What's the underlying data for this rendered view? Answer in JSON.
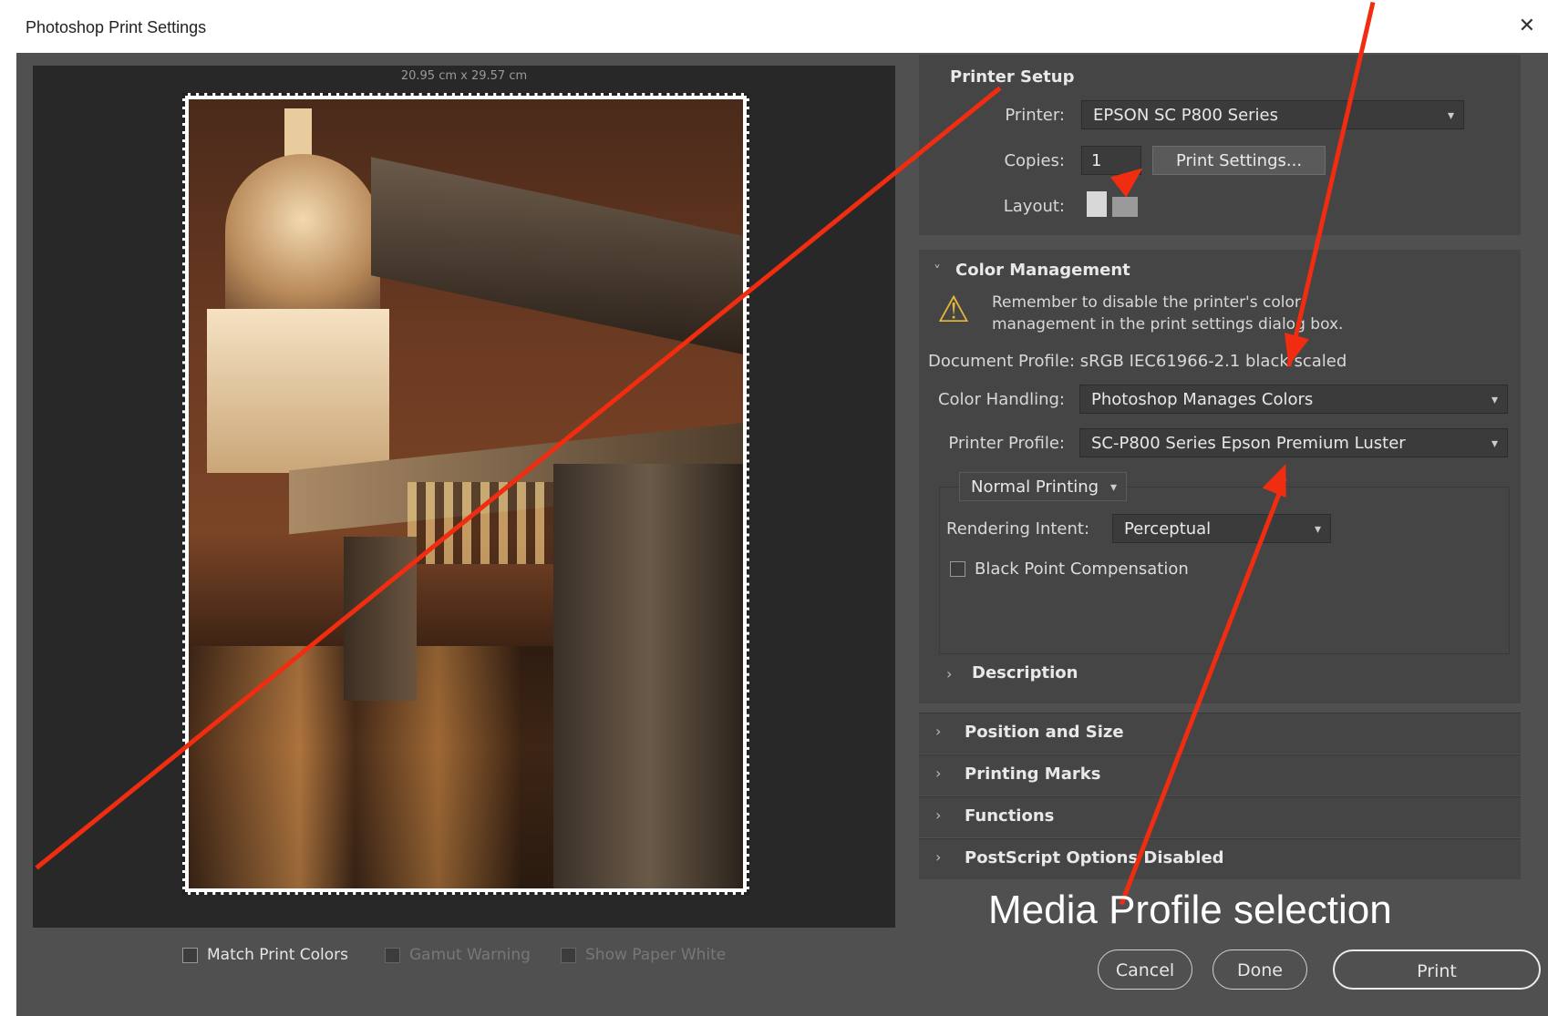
{
  "window": {
    "title": "Photoshop Print Settings",
    "close_glyph": "✕"
  },
  "preview": {
    "size_label": "20.95 cm x 29.57 cm",
    "photo_description_icon": "photo-preview-image"
  },
  "bottom_options": {
    "match_print_colors": "Match Print Colors",
    "gamut_warning": "Gamut Warning",
    "show_paper_white": "Show Paper White"
  },
  "printer_setup": {
    "title": "Printer Setup",
    "printer_label": "Printer:",
    "printer_value": "EPSON SC P800 Series",
    "copies_label": "Copies:",
    "copies_value": "1",
    "print_settings_button": "Print Settings...",
    "layout_label": "Layout:"
  },
  "color_management": {
    "title": "Color Management",
    "warning_line1": "Remember to disable the printer's color",
    "warning_line2": "management in the print settings dialog box.",
    "document_profile": "Document Profile: sRGB IEC61966-2.1 black scaled",
    "color_handling_label": "Color Handling:",
    "color_handling_value": "Photoshop Manages Colors",
    "printer_profile_label": "Printer Profile:",
    "printer_profile_value": "SC-P800 Series Epson Premium Luster",
    "normal_printing": "Normal Printing",
    "rendering_intent_label": "Rendering Intent:",
    "rendering_intent_value": "Perceptual",
    "black_point_compensation": "Black Point Compensation",
    "description": "Description"
  },
  "sections": [
    {
      "label": "Position and Size"
    },
    {
      "label": "Printing Marks"
    },
    {
      "label": "Functions"
    },
    {
      "label": "PostScript Options Disabled"
    }
  ],
  "buttons": {
    "cancel": "Cancel",
    "done": "Done",
    "print": "Print"
  },
  "annotation": {
    "text": "Media Profile selection",
    "color": "#f02d10"
  }
}
